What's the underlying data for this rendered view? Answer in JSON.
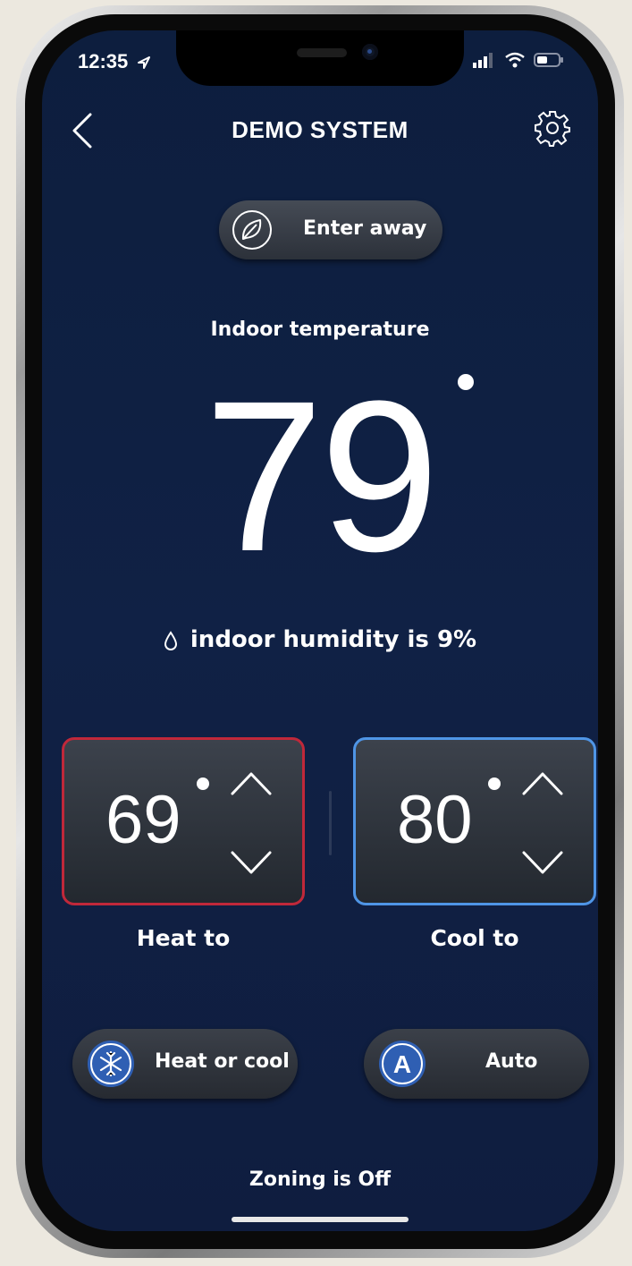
{
  "status_bar": {
    "time": "12:35"
  },
  "header": {
    "title": "DEMO SYSTEM"
  },
  "away": {
    "label": "Enter away"
  },
  "indoor": {
    "label": "Indoor temperature",
    "temperature": "79"
  },
  "humidity": {
    "text": "indoor humidity is 9%"
  },
  "heat": {
    "value": "69",
    "label": "Heat to",
    "color": "#c0283a"
  },
  "cool": {
    "value": "80",
    "label": "Cool to",
    "color": "#4f95e6"
  },
  "mode": {
    "label": "Heat or cool",
    "icon": "heat-cool-icon"
  },
  "fan": {
    "label": "Auto",
    "icon_letter": "A"
  },
  "zoning": {
    "text": "Zoning is Off"
  },
  "colors": {
    "background": "#102145",
    "accent": "#2f5fb3"
  }
}
